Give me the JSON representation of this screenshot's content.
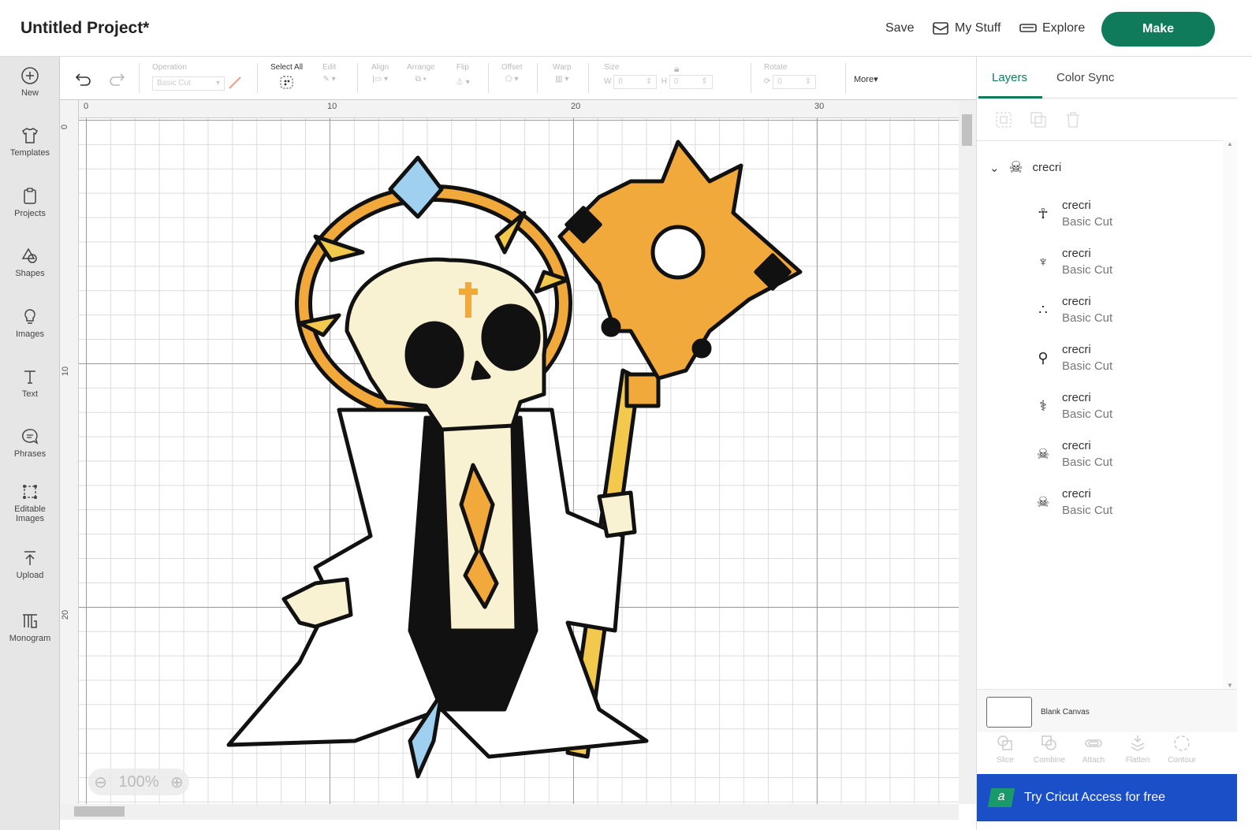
{
  "header": {
    "title": "Untitled Project*",
    "save": "Save",
    "my_stuff": "My Stuff",
    "explore": "Explore",
    "make": "Make"
  },
  "sidebar": [
    {
      "label": "New"
    },
    {
      "label": "Templates"
    },
    {
      "label": "Projects"
    },
    {
      "label": "Shapes"
    },
    {
      "label": "Images"
    },
    {
      "label": "Text"
    },
    {
      "label": "Phrases"
    },
    {
      "label": "Editable Images"
    },
    {
      "label": "Upload"
    },
    {
      "label": "Monogram"
    }
  ],
  "toolbar": {
    "operation_label": "Operation",
    "operation_value": "Basic Cut",
    "select_all": "Select All",
    "edit": "Edit",
    "align": "Align",
    "arrange": "Arrange",
    "flip": "Flip",
    "offset": "Offset",
    "warp": "Warp",
    "size": "Size",
    "w_label": "W",
    "w_value": "0",
    "h_label": "H",
    "h_value": "0",
    "rotate": "Rotate",
    "rotate_value": "0",
    "more": "More"
  },
  "rulers": {
    "top": [
      "0",
      "10",
      "20",
      "30"
    ],
    "left": [
      "0",
      "10",
      "20"
    ]
  },
  "zoom": {
    "level": "100%"
  },
  "panel": {
    "tabs": [
      "Layers",
      "Color Sync"
    ],
    "group": {
      "name": "crecri"
    },
    "layers": [
      {
        "name": "crecri",
        "operation": "Basic Cut"
      },
      {
        "name": "crecri",
        "operation": "Basic Cut"
      },
      {
        "name": "crecri",
        "operation": "Basic Cut"
      },
      {
        "name": "crecri",
        "operation": "Basic Cut"
      },
      {
        "name": "crecri",
        "operation": "Basic Cut"
      },
      {
        "name": "crecri",
        "operation": "Basic Cut"
      },
      {
        "name": "crecri",
        "operation": "Basic Cut"
      }
    ],
    "blank_canvas": "Blank Canvas",
    "tools": [
      "Slice",
      "Combine",
      "Attach",
      "Flatten",
      "Contour"
    ],
    "banner": {
      "badge": "a",
      "text": "Try Cricut Access for free"
    }
  },
  "colors": {
    "accent": "#0f7b5a",
    "banner": "#1a4fc8",
    "gold": "#f2a93b",
    "bone": "#f8f1d2"
  }
}
